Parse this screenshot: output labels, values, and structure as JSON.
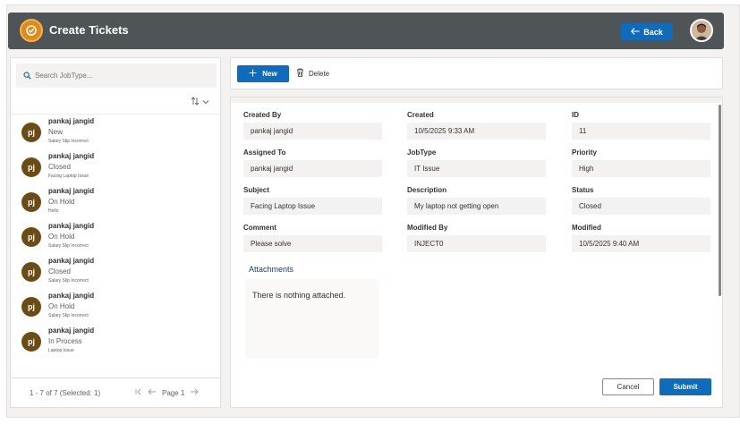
{
  "app": {
    "title": "Create Tickets"
  },
  "header": {
    "back_label": "Back"
  },
  "search": {
    "placeholder": "Search JobType..."
  },
  "list": {
    "items": [
      {
        "initials": "pj",
        "name": "pankaj jangid",
        "status": "New",
        "subject": "Salary Slip Incorrect"
      },
      {
        "initials": "pj",
        "name": "pankaj jangid",
        "status": "Closed",
        "subject": "Facing Laptop Issue"
      },
      {
        "initials": "pj",
        "name": "pankaj jangid",
        "status": "On Hold",
        "subject": "Hello"
      },
      {
        "initials": "pj",
        "name": "pankaj jangid",
        "status": "On Hold",
        "subject": "Salary Slip Incorrect"
      },
      {
        "initials": "pj",
        "name": "pankaj jangid",
        "status": "Closed",
        "subject": "Salary Slip Incorrect"
      },
      {
        "initials": "pj",
        "name": "pankaj jangid",
        "status": "On Hold",
        "subject": "Salary Slip Incorrect"
      },
      {
        "initials": "pj",
        "name": "pankaj jangid",
        "status": "In Process",
        "subject": "Laptop Issue"
      }
    ]
  },
  "pager": {
    "count_text": "1 - 7 of 7 (Selected: 1)",
    "page_text": "Page 1"
  },
  "toolbar": {
    "new_label": "New",
    "delete_label": "Delete"
  },
  "form": {
    "created_by": {
      "label": "Created By",
      "value": "pankaj jangid"
    },
    "created": {
      "label": "Created",
      "value": "10/5/2025 9:33 AM"
    },
    "id": {
      "label": "ID",
      "value": "11"
    },
    "assigned_to": {
      "label": "Assigned To",
      "value": "pankaj jangid"
    },
    "jobtype": {
      "label": "JobType",
      "value": "IT Issue"
    },
    "priority": {
      "label": "Priority",
      "value": "High"
    },
    "subject": {
      "label": "Subject",
      "value": "Facing Laptop Issue"
    },
    "description": {
      "label": "Description",
      "value": "My laptop not getting open"
    },
    "status": {
      "label": "Status",
      "value": "Closed"
    },
    "comment": {
      "label": "Comment",
      "value": "Please solve"
    },
    "modified_by": {
      "label": "Modified By",
      "value": "INJECT0"
    },
    "modified": {
      "label": "Modified",
      "value": "10/5/2025 9:40 AM"
    },
    "attachments_title": "Attachments",
    "attachments_empty": "There is nothing attached.",
    "cancel_label": "Cancel",
    "submit_label": "Submit"
  },
  "colors": {
    "header_bg": "#4f5457",
    "accent": "#0f6cbd",
    "avatar_bg": "#6b4c14"
  },
  "icons": [
    "settings-logo-icon",
    "back-arrow-icon",
    "user-avatar",
    "search-icon",
    "sort-icon",
    "chevron-down-icon",
    "plus-icon",
    "trash-icon",
    "first-page-icon",
    "prev-page-icon",
    "next-page-icon"
  ]
}
